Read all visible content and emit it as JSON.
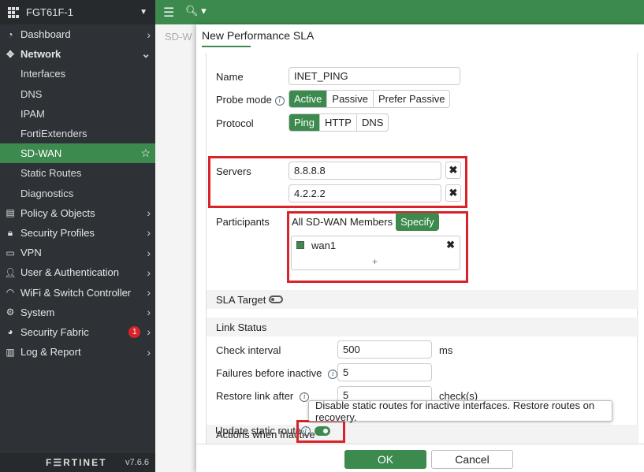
{
  "device": {
    "name": "FGT61F-1"
  },
  "sidebar": {
    "items": [
      {
        "label": "Dashboard",
        "icon": "dashboard-icon"
      },
      {
        "label": "Network",
        "icon": "network-icon"
      },
      {
        "label": "Policy & Objects",
        "icon": "policy-icon"
      },
      {
        "label": "Security Profiles",
        "icon": "lock-icon"
      },
      {
        "label": "VPN",
        "icon": "monitor-icon"
      },
      {
        "label": "User & Authentication",
        "icon": "user-icon"
      },
      {
        "label": "WiFi & Switch Controller",
        "icon": "wifi-icon"
      },
      {
        "label": "System",
        "icon": "gear-icon"
      },
      {
        "label": "Security Fabric",
        "icon": "fabric-icon",
        "badge": "1"
      },
      {
        "label": "Log & Report",
        "icon": "chart-icon"
      }
    ],
    "network_sub": [
      "Interfaces",
      "DNS",
      "IPAM",
      "FortiExtenders",
      "SD-WAN",
      "Static Routes",
      "Diagnostics"
    ],
    "active_sub": "SD-WAN"
  },
  "footer": {
    "brand": "F☰RTINET",
    "version": "v7.6.6"
  },
  "background": {
    "title": "SD-W"
  },
  "dialog": {
    "title": "New Performance SLA",
    "name_label": "Name",
    "name_value": "INET_PING",
    "probe_mode_label": "Probe mode",
    "probe_modes": [
      "Active",
      "Passive",
      "Prefer Passive"
    ],
    "protocol_label": "Protocol",
    "protocols": [
      "Ping",
      "HTTP",
      "DNS"
    ],
    "servers_label": "Servers",
    "server1": "8.8.8.8",
    "server2": "4.2.2.2",
    "participants_label": "Participants",
    "participant_modes": [
      "All SD-WAN Members",
      "Specify"
    ],
    "participant_item": "wan1",
    "add_symbol": "+",
    "sla_target_label": "SLA Target",
    "link_status_label": "Link Status",
    "check_interval_label": "Check interval",
    "check_interval_value": "500",
    "check_interval_unit": "ms",
    "failures_label": "Failures before inactive",
    "failures_value": "5",
    "restore_label": "Restore link after",
    "restore_value": "5",
    "restore_unit": "check(s)",
    "actions_label": "Actions when Inactive",
    "update_route_label": "Update static route",
    "tooltip": "Disable static routes for inactive interfaces. Restore routes on recovery.",
    "ok_label": "OK",
    "cancel_label": "Cancel"
  },
  "colors": {
    "accent": "#3c8a4e",
    "highlight": "#d8232a",
    "sidebar": "#2e3236"
  }
}
